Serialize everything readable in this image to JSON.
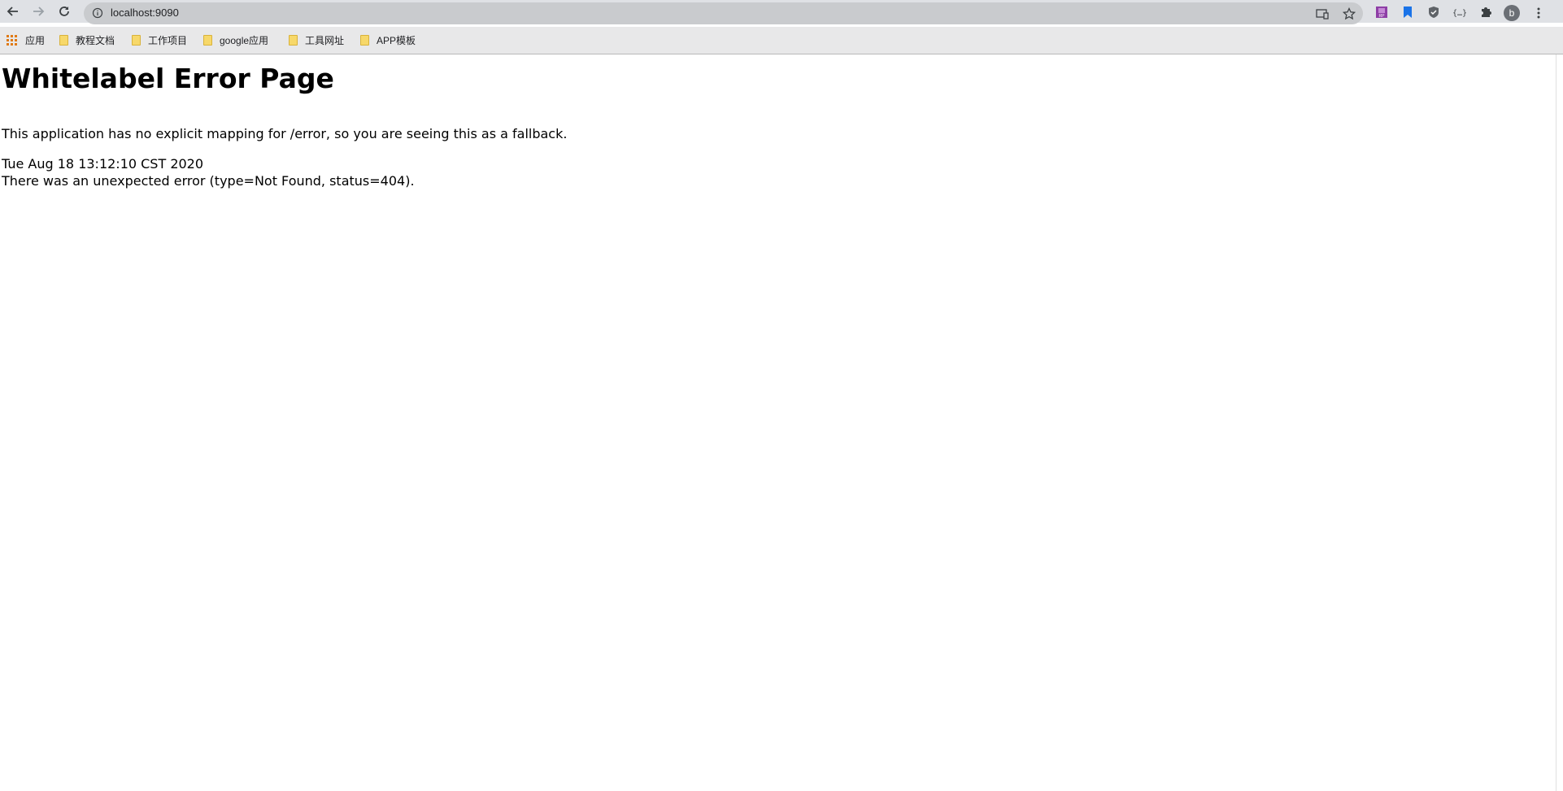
{
  "browser": {
    "url": "localhost:9090",
    "avatar_letter": "b",
    "icons": {
      "back": "arrow-left-icon",
      "forward": "arrow-right-icon",
      "reload": "reload-icon",
      "info": "info-icon",
      "cast": "cast-icon",
      "bookmark_star": "star-icon",
      "extensions": [
        "rp-extension-icon",
        "bookmark-extension-icon",
        "shield-extension-icon",
        "braces-extension-icon",
        "puzzle-icon"
      ],
      "menu": "kebab-menu-icon"
    }
  },
  "bookmarks": {
    "apps_label": "应用",
    "items": [
      "教程文档",
      "工作项目",
      "google应用",
      "工具网址",
      "APP模板"
    ]
  },
  "page": {
    "title": "Whitelabel Error Page",
    "message": "This application has no explicit mapping for /error, so you are seeing this as a fallback.",
    "timestamp": "Tue Aug 18 13:12:10 CST 2020",
    "error": "There was an unexpected error (type=Not Found, status=404)."
  },
  "colors": {
    "toolbar_bg": "#dfe1e5",
    "omnibox_bg": "#c9cbce",
    "bookmarks_bg": "#e8e8e9",
    "folder": "#f7d86a",
    "apps_grid": "#e07a15"
  }
}
